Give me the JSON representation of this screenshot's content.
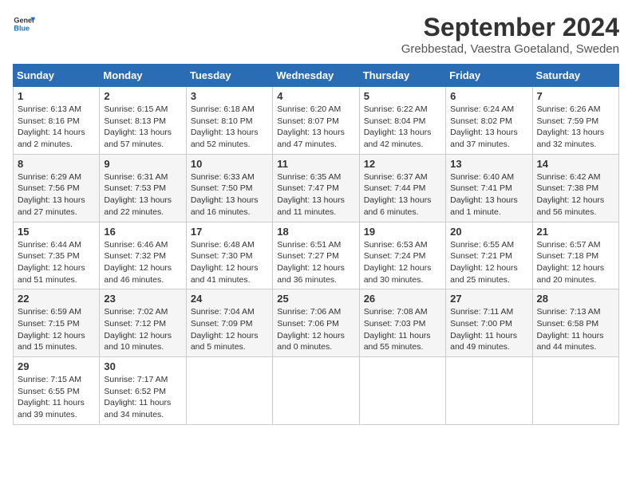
{
  "header": {
    "logo_line1": "General",
    "logo_line2": "Blue",
    "main_title": "September 2024",
    "subtitle": "Grebbestad, Vaestra Goetaland, Sweden"
  },
  "calendar": {
    "days_of_week": [
      "Sunday",
      "Monday",
      "Tuesday",
      "Wednesday",
      "Thursday",
      "Friday",
      "Saturday"
    ],
    "weeks": [
      [
        {
          "day": "1",
          "info": "Sunrise: 6:13 AM\nSunset: 8:16 PM\nDaylight: 14 hours\nand 2 minutes."
        },
        {
          "day": "2",
          "info": "Sunrise: 6:15 AM\nSunset: 8:13 PM\nDaylight: 13 hours\nand 57 minutes."
        },
        {
          "day": "3",
          "info": "Sunrise: 6:18 AM\nSunset: 8:10 PM\nDaylight: 13 hours\nand 52 minutes."
        },
        {
          "day": "4",
          "info": "Sunrise: 6:20 AM\nSunset: 8:07 PM\nDaylight: 13 hours\nand 47 minutes."
        },
        {
          "day": "5",
          "info": "Sunrise: 6:22 AM\nSunset: 8:04 PM\nDaylight: 13 hours\nand 42 minutes."
        },
        {
          "day": "6",
          "info": "Sunrise: 6:24 AM\nSunset: 8:02 PM\nDaylight: 13 hours\nand 37 minutes."
        },
        {
          "day": "7",
          "info": "Sunrise: 6:26 AM\nSunset: 7:59 PM\nDaylight: 13 hours\nand 32 minutes."
        }
      ],
      [
        {
          "day": "8",
          "info": "Sunrise: 6:29 AM\nSunset: 7:56 PM\nDaylight: 13 hours\nand 27 minutes."
        },
        {
          "day": "9",
          "info": "Sunrise: 6:31 AM\nSunset: 7:53 PM\nDaylight: 13 hours\nand 22 minutes."
        },
        {
          "day": "10",
          "info": "Sunrise: 6:33 AM\nSunset: 7:50 PM\nDaylight: 13 hours\nand 16 minutes."
        },
        {
          "day": "11",
          "info": "Sunrise: 6:35 AM\nSunset: 7:47 PM\nDaylight: 13 hours\nand 11 minutes."
        },
        {
          "day": "12",
          "info": "Sunrise: 6:37 AM\nSunset: 7:44 PM\nDaylight: 13 hours\nand 6 minutes."
        },
        {
          "day": "13",
          "info": "Sunrise: 6:40 AM\nSunset: 7:41 PM\nDaylight: 13 hours\nand 1 minute."
        },
        {
          "day": "14",
          "info": "Sunrise: 6:42 AM\nSunset: 7:38 PM\nDaylight: 12 hours\nand 56 minutes."
        }
      ],
      [
        {
          "day": "15",
          "info": "Sunrise: 6:44 AM\nSunset: 7:35 PM\nDaylight: 12 hours\nand 51 minutes."
        },
        {
          "day": "16",
          "info": "Sunrise: 6:46 AM\nSunset: 7:32 PM\nDaylight: 12 hours\nand 46 minutes."
        },
        {
          "day": "17",
          "info": "Sunrise: 6:48 AM\nSunset: 7:30 PM\nDaylight: 12 hours\nand 41 minutes."
        },
        {
          "day": "18",
          "info": "Sunrise: 6:51 AM\nSunset: 7:27 PM\nDaylight: 12 hours\nand 36 minutes."
        },
        {
          "day": "19",
          "info": "Sunrise: 6:53 AM\nSunset: 7:24 PM\nDaylight: 12 hours\nand 30 minutes."
        },
        {
          "day": "20",
          "info": "Sunrise: 6:55 AM\nSunset: 7:21 PM\nDaylight: 12 hours\nand 25 minutes."
        },
        {
          "day": "21",
          "info": "Sunrise: 6:57 AM\nSunset: 7:18 PM\nDaylight: 12 hours\nand 20 minutes."
        }
      ],
      [
        {
          "day": "22",
          "info": "Sunrise: 6:59 AM\nSunset: 7:15 PM\nDaylight: 12 hours\nand 15 minutes."
        },
        {
          "day": "23",
          "info": "Sunrise: 7:02 AM\nSunset: 7:12 PM\nDaylight: 12 hours\nand 10 minutes."
        },
        {
          "day": "24",
          "info": "Sunrise: 7:04 AM\nSunset: 7:09 PM\nDaylight: 12 hours\nand 5 minutes."
        },
        {
          "day": "25",
          "info": "Sunrise: 7:06 AM\nSunset: 7:06 PM\nDaylight: 12 hours\nand 0 minutes."
        },
        {
          "day": "26",
          "info": "Sunrise: 7:08 AM\nSunset: 7:03 PM\nDaylight: 11 hours\nand 55 minutes."
        },
        {
          "day": "27",
          "info": "Sunrise: 7:11 AM\nSunset: 7:00 PM\nDaylight: 11 hours\nand 49 minutes."
        },
        {
          "day": "28",
          "info": "Sunrise: 7:13 AM\nSunset: 6:58 PM\nDaylight: 11 hours\nand 44 minutes."
        }
      ],
      [
        {
          "day": "29",
          "info": "Sunrise: 7:15 AM\nSunset: 6:55 PM\nDaylight: 11 hours\nand 39 minutes."
        },
        {
          "day": "30",
          "info": "Sunrise: 7:17 AM\nSunset: 6:52 PM\nDaylight: 11 hours\nand 34 minutes."
        },
        {
          "day": "",
          "info": ""
        },
        {
          "day": "",
          "info": ""
        },
        {
          "day": "",
          "info": ""
        },
        {
          "day": "",
          "info": ""
        },
        {
          "day": "",
          "info": ""
        }
      ]
    ]
  }
}
